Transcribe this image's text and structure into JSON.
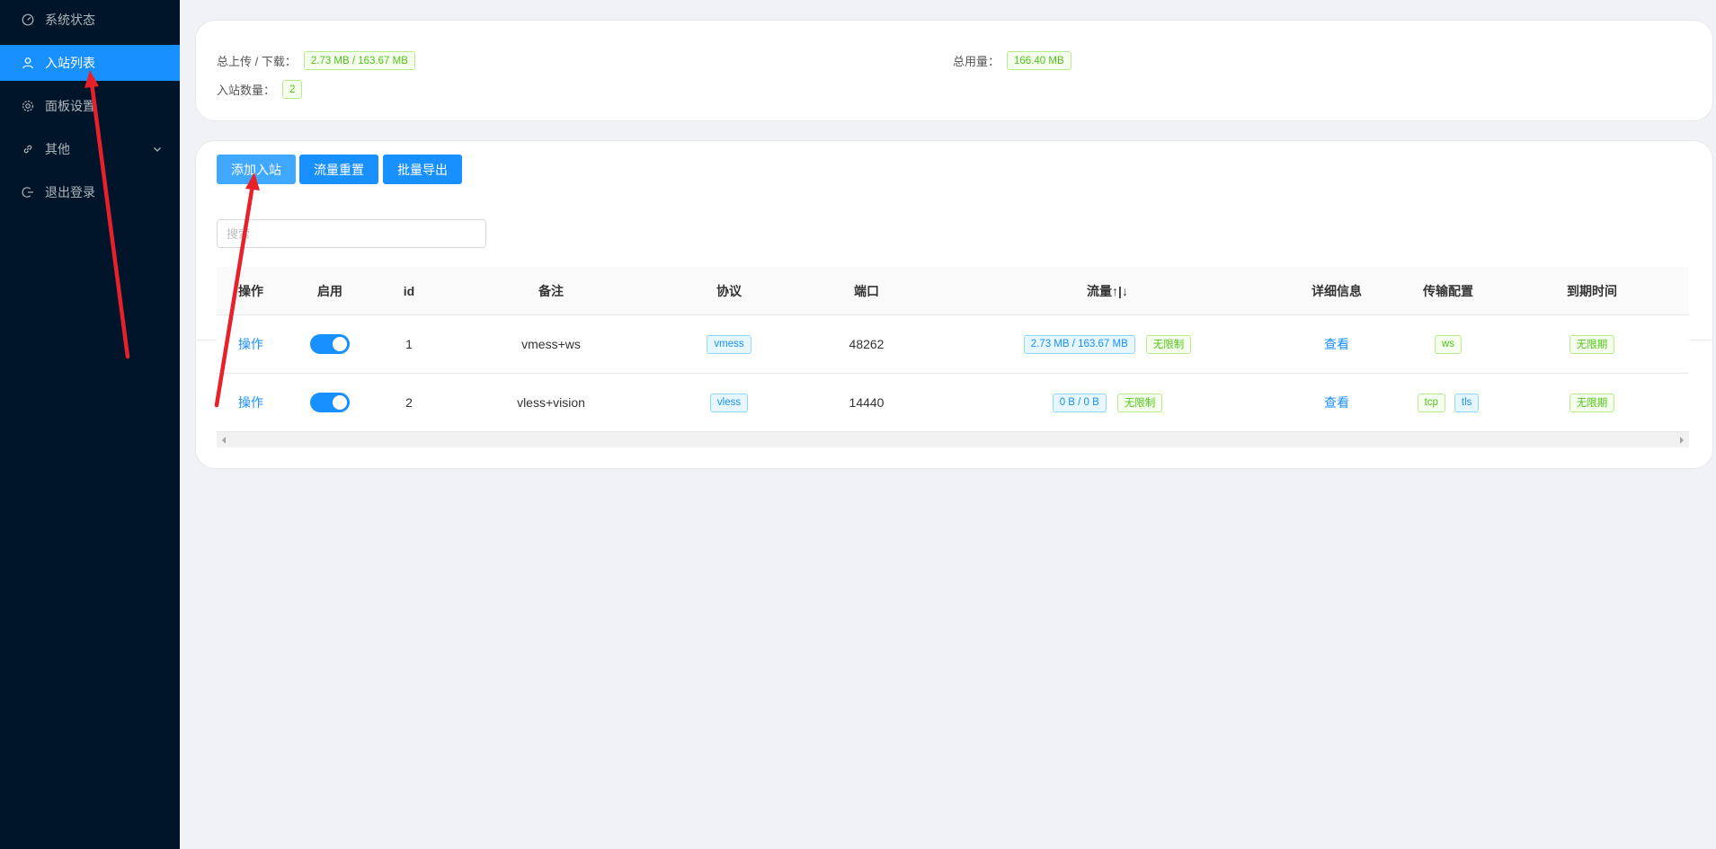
{
  "sidebar": {
    "items": [
      {
        "label": "系统状态",
        "icon": "dashboard-icon"
      },
      {
        "label": "入站列表",
        "icon": "user-icon",
        "active": true
      },
      {
        "label": "面板设置",
        "icon": "gear-icon"
      },
      {
        "label": "其他",
        "icon": "link-icon"
      },
      {
        "label": "退出登录",
        "icon": "logout-icon"
      }
    ]
  },
  "stats": {
    "traffic_label": "总上传 / 下载：",
    "traffic_value": "2.73 MB / 163.67 MB",
    "usage_label": "总用量：",
    "usage_value": "166.40 MB",
    "count_label": "入站数量：",
    "count_value": "2"
  },
  "toolbar": {
    "add_label": "添加入站",
    "reset_label": "流量重置",
    "export_label": "批量导出"
  },
  "search": {
    "placeholder": "搜索"
  },
  "table": {
    "columns": [
      "操作",
      "启用",
      "id",
      "备注",
      "协议",
      "端口",
      "流量↑|↓",
      "详细信息",
      "传输配置",
      "到期时间"
    ],
    "rows": [
      {
        "action": "操作",
        "enabled": true,
        "id": "1",
        "remark": "vmess+ws",
        "protocol": "vmess",
        "port": "48262",
        "traffic": "2.73 MB / 163.67 MB",
        "limit": "无限制",
        "detail": "查看",
        "transport": [
          "ws"
        ],
        "expiry": "无限期"
      },
      {
        "action": "操作",
        "enabled": true,
        "id": "2",
        "remark": "vless+vision",
        "protocol": "vless",
        "port": "14440",
        "traffic": "0 B / 0 B",
        "limit": "无限制",
        "detail": "查看",
        "transport": [
          "tcp",
          "tls"
        ],
        "expiry": "无限期"
      }
    ]
  },
  "colors": {
    "sidebar_bg": "#001529",
    "primary": "#1890ff",
    "tag_green": "#52c41a",
    "annotation_red": "#e8202a"
  }
}
